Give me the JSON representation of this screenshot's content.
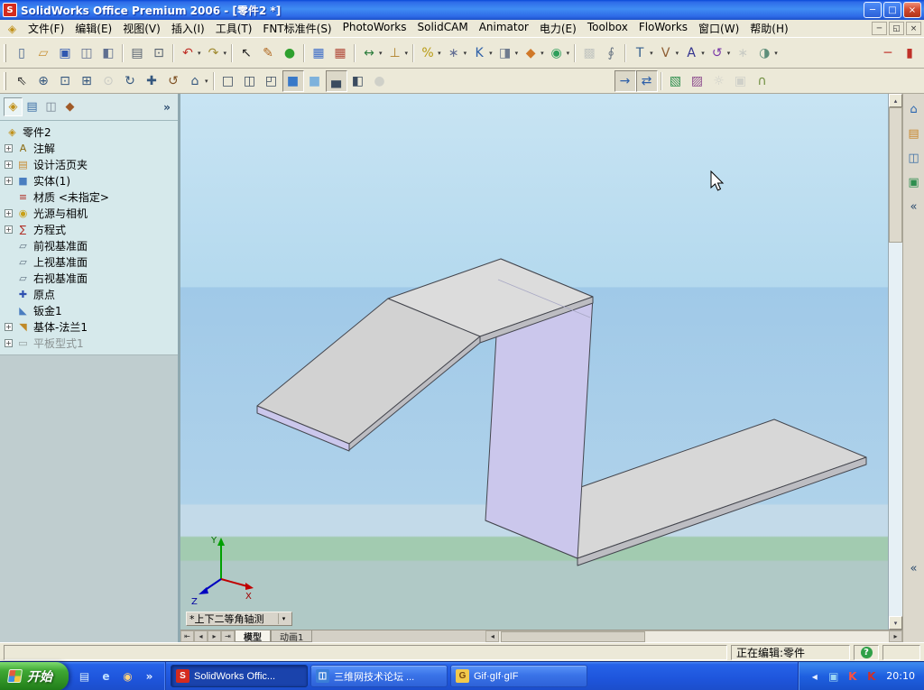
{
  "window_title": "SolidWorks Office Premium 2006 - [零件2 *]",
  "title_controls": [
    {
      "name": "minimize-button",
      "glyph": "─"
    },
    {
      "name": "maximize-button",
      "glyph": "□"
    },
    {
      "name": "close-button",
      "glyph": "×",
      "close": true
    }
  ],
  "menu_bar": {
    "items": [
      "文件(F)",
      "编辑(E)",
      "视图(V)",
      "插入(I)",
      "工具(T)",
      "FNT标准件(S)",
      "PhotoWorks",
      "SolidCAM",
      "Animator",
      "电力(E)",
      "Toolbox",
      "FloWorks",
      "窗口(W)",
      "帮助(H)"
    ],
    "doc_icon_glyph": "◈",
    "mdi_buttons": [
      {
        "name": "mdi-minimize-button",
        "glyph": "─"
      },
      {
        "name": "mdi-restore-button",
        "glyph": "◱"
      },
      {
        "name": "mdi-close-button",
        "glyph": "×"
      }
    ]
  },
  "toolbar_main": {
    "items": [
      {
        "name": "new-document-icon",
        "glyph": "▯",
        "color": "#44628E"
      },
      {
        "name": "open-document-icon",
        "glyph": "▱",
        "color": "#C89238"
      },
      {
        "name": "save-icon",
        "glyph": "▣",
        "color": "#3058B0"
      },
      {
        "name": "make-drawing-icon",
        "glyph": "◫",
        "color": "#607090"
      },
      {
        "name": "make-assembly-icon",
        "glyph": "◧",
        "color": "#607090"
      },
      {
        "sep": true
      },
      {
        "name": "print-icon",
        "glyph": "▤",
        "color": "#55606E"
      },
      {
        "name": "print-preview-icon",
        "glyph": "⊡",
        "color": "#55606E"
      },
      {
        "sep": true
      },
      {
        "name": "undo-icon",
        "glyph": "↶",
        "color": "#C03028",
        "dd": true
      },
      {
        "name": "redo-icon",
        "glyph": "↷",
        "color": "#A08A30",
        "dd": true
      },
      {
        "sep": true
      },
      {
        "name": "select-icon",
        "glyph": "↖",
        "color": "#222222"
      },
      {
        "name": "sketch-icon",
        "glyph": "✎",
        "color": "#B06820"
      },
      {
        "name": "rebuild-icon",
        "glyph": "●",
        "color": "#2EA02E"
      },
      {
        "sep": true
      },
      {
        "name": "sketch-grid-icon",
        "glyph": "▦",
        "color": "#3C6CC8"
      },
      {
        "name": "drawing-grid-icon",
        "glyph": "▦",
        "color": "#B04838"
      },
      {
        "sep": true
      },
      {
        "name": "dimension-icon",
        "glyph": "↔",
        "color": "#2E7E3E",
        "dd": true
      },
      {
        "name": "relations-icon",
        "glyph": "⊥",
        "color": "#B08028",
        "dd": true
      },
      {
        "sep": true
      },
      {
        "name": "features-icon",
        "glyph": "%",
        "color": "#B89A10",
        "dd": true
      },
      {
        "name": "pattern-icon",
        "glyph": "∗",
        "color": "#606C92",
        "dd": true
      },
      {
        "name": "measure-icon",
        "glyph": "K",
        "color": "#2D5FA8",
        "dd": true
      },
      {
        "name": "section-tool-icon",
        "glyph": "◨",
        "color": "#707C8E",
        "dd": true
      },
      {
        "name": "curvature-tool-icon",
        "glyph": "◆",
        "color": "#D07828",
        "dd": true
      },
      {
        "name": "simulation-icon",
        "glyph": "◉",
        "color": "#2E9E5B",
        "dd": true
      },
      {
        "sep": true
      },
      {
        "name": "tolerance-icon",
        "glyph": "▩",
        "color": "#8A94A0",
        "disabled": true
      },
      {
        "name": "attachment-icon",
        "glyph": "∮",
        "color": "#6A7684"
      },
      {
        "sep": true
      },
      {
        "name": "toolbox-icon",
        "glyph": "T",
        "color": "#335E8E",
        "dd": true
      },
      {
        "name": "vault-icon",
        "glyph": "V",
        "color": "#8E5E33",
        "dd": true
      },
      {
        "name": "analysis-icon",
        "glyph": "A",
        "color": "#32328E",
        "dd": true
      },
      {
        "name": "floworks-icon",
        "glyph": "↺",
        "color": "#7A38A8",
        "dd": true
      },
      {
        "name": "motion-icon",
        "glyph": "∗",
        "color": "#9AA4AA",
        "disabled": true
      },
      {
        "name": "render-icon",
        "glyph": "◑",
        "color": "#5E8E7A",
        "dd": true
      }
    ],
    "right_items": [
      {
        "name": "collapse-toolbar-icon",
        "glyph": "─",
        "color": "#C03028"
      },
      {
        "name": "expand-toolbar-icon",
        "glyph": "▮",
        "color": "#C03028"
      }
    ]
  },
  "toolbar_view": {
    "items": [
      {
        "name": "select-filter-icon",
        "glyph": "⇖",
        "color": "#333333"
      },
      {
        "name": "zoom-in-out-icon",
        "glyph": "⊕",
        "color": "#35577E"
      },
      {
        "name": "zoom-fit-icon",
        "glyph": "⊡",
        "color": "#35577E"
      },
      {
        "name": "zoom-area-icon",
        "glyph": "⊞",
        "color": "#35577E"
      },
      {
        "name": "zoom-selection-icon",
        "glyph": "⊙",
        "color": "#9AA0A8",
        "disabled": true
      },
      {
        "name": "rotate-view-icon",
        "glyph": "↻",
        "color": "#35577E"
      },
      {
        "name": "pan-icon",
        "glyph": "✚",
        "color": "#35577E"
      },
      {
        "name": "rotate-3d-icon",
        "glyph": "↺",
        "color": "#7E5022"
      },
      {
        "name": "standard-views-icon",
        "glyph": "⌂",
        "color": "#35577E",
        "dd": true
      },
      {
        "sep": true
      },
      {
        "name": "wireframe-icon",
        "glyph": "□",
        "color": "#3C4C60"
      },
      {
        "name": "hidden-lines-visible-icon",
        "glyph": "◫",
        "color": "#3C4C60"
      },
      {
        "name": "hidden-lines-removed-icon",
        "glyph": "◰",
        "color": "#3C4C60"
      },
      {
        "name": "shaded-with-edges-icon",
        "glyph": "■",
        "color": "#3878C8",
        "pressed": true
      },
      {
        "name": "shaded-icon",
        "glyph": "■",
        "color": "#7EB2DC"
      },
      {
        "name": "shadows-icon",
        "glyph": "▄",
        "color": "#3C4C60",
        "pressed": true
      },
      {
        "name": "section-view-icon",
        "glyph": "◧",
        "color": "#3C4C60"
      },
      {
        "name": "realview-icon",
        "glyph": "●",
        "color": "#A8AEB4",
        "disabled": true
      },
      {
        "space": true
      },
      {
        "name": "normal-to-icon",
        "glyph": "→",
        "color": "#2D5FA8",
        "pressed": true
      },
      {
        "name": "link-views-icon",
        "glyph": "⇄",
        "color": "#2D5FA8",
        "pressed": true
      },
      {
        "sep": true
      },
      {
        "name": "apply-scene-icon",
        "glyph": "▧",
        "color": "#2E8E4E"
      },
      {
        "name": "edit-scene-icon",
        "glyph": "▨",
        "color": "#8E4E8E"
      },
      {
        "name": "lights-icon",
        "glyph": "☼",
        "color": "#A8AEB4",
        "disabled": true
      },
      {
        "name": "camera-icon",
        "glyph": "▣",
        "color": "#A8AEB4",
        "disabled": true
      },
      {
        "name": "curvature-display-icon",
        "glyph": "∩",
        "color": "#6E8E3E"
      }
    ]
  },
  "feature_tree": {
    "header_tabs": [
      {
        "name": "tab-featuremanager",
        "glyph": "◈",
        "color": "#C09018",
        "pressed": true
      },
      {
        "name": "tab-propertymanager",
        "glyph": "▤",
        "color": "#3A6EA5"
      },
      {
        "name": "tab-configurationmanager",
        "glyph": "◫",
        "color": "#7A8694"
      },
      {
        "name": "tab-add-in",
        "glyph": "◆",
        "color": "#A05A28"
      }
    ],
    "collapse_glyph": "»",
    "items": [
      {
        "label": "零件2",
        "icon": "part",
        "icon_glyph": "◈",
        "icon_color": "#C09018",
        "root": true
      },
      {
        "label": "注解",
        "icon": "annotations",
        "icon_glyph": "A",
        "icon_color": "#8A6A10",
        "plus": true
      },
      {
        "label": "设计活页夹",
        "icon": "design-binder",
        "icon_glyph": "▤",
        "icon_color": "#C8862A",
        "plus": true
      },
      {
        "label": "实体(1)",
        "icon": "solid-bodies",
        "icon_glyph": "■",
        "icon_color": "#4A7EC0",
        "plus": true
      },
      {
        "label": "材质 <未指定>",
        "icon": "material",
        "icon_glyph": "≡",
        "icon_color": "#B03028"
      },
      {
        "label": "光源与相机",
        "icon": "lights-cameras",
        "icon_glyph": "◉",
        "icon_color": "#C8A018",
        "plus": true
      },
      {
        "label": "方程式",
        "icon": "equations",
        "icon_glyph": "∑",
        "icon_color": "#B03028",
        "plus": true
      },
      {
        "label": "前视基准面",
        "icon": "front-plane",
        "icon_glyph": "▱",
        "icon_color": "#5E7080"
      },
      {
        "label": "上视基准面",
        "icon": "top-plane",
        "icon_glyph": "▱",
        "icon_color": "#5E7080"
      },
      {
        "label": "右视基准面",
        "icon": "right-plane",
        "icon_glyph": "▱",
        "icon_color": "#5E7080"
      },
      {
        "label": "原点",
        "icon": "origin",
        "icon_glyph": "✚",
        "icon_color": "#2E50B0"
      },
      {
        "label": "钣金1",
        "icon": "sheet-metal",
        "icon_glyph": "◣",
        "icon_color": "#4A7EC0"
      },
      {
        "label": "基体-法兰1",
        "icon": "base-flange",
        "icon_glyph": "◥",
        "icon_color": "#C08A28",
        "plus": true
      },
      {
        "label": "平板型式1",
        "icon": "flat-pattern",
        "icon_glyph": "▭",
        "icon_color": "#909A9A",
        "plus": true,
        "grayed": true
      }
    ]
  },
  "viewport": {
    "view_label": "*上下二等角轴测",
    "view_dropdown_glyph": "▾",
    "triad": {
      "x": "X",
      "y": "Y",
      "z": "Z"
    },
    "tabs": [
      {
        "name": "model-tab",
        "label": "模型",
        "active": true
      },
      {
        "name": "animation-tab",
        "label": "动画1",
        "active": false
      }
    ],
    "nav_buttons": [
      {
        "name": "tab-first-button",
        "glyph": "⇤"
      },
      {
        "name": "tab-prev-button",
        "glyph": "◂"
      },
      {
        "name": "tab-next-button",
        "glyph": "▸"
      },
      {
        "name": "tab-last-button",
        "glyph": "⇥"
      }
    ],
    "scroll": {
      "up": "▴",
      "down": "▾",
      "left": "◂",
      "right": "▸"
    }
  },
  "task_pane": {
    "icons": [
      {
        "name": "solidworks-resources-icon",
        "glyph": "⌂",
        "color": "#2A66B0"
      },
      {
        "name": "design-library-icon",
        "glyph": "▤",
        "color": "#C8862A"
      },
      {
        "name": "file-explorer-icon",
        "glyph": "◫",
        "color": "#3A6EA5"
      },
      {
        "name": "view-palette-icon",
        "glyph": "▣",
        "color": "#2E8E4E"
      },
      {
        "name": "collapse-taskpane-icon",
        "glyph": "«",
        "color": "#2A4A6E"
      }
    ],
    "lower_collapse_glyph": "«"
  },
  "status_bar": {
    "editing": "正在编辑:零件",
    "help_glyph": "?"
  },
  "taskbar": {
    "start_label": "开始",
    "quick_launch": [
      {
        "name": "show-desktop-icon",
        "glyph": "▤",
        "color": "#D8ECFA"
      },
      {
        "name": "internet-explorer-icon",
        "glyph": "e",
        "color": "#BFE0FF"
      },
      {
        "name": "media-player-icon",
        "glyph": "◉",
        "color": "#FFD27E"
      },
      {
        "name": "quick-launch-more-icon",
        "glyph": "»",
        "color": "#E8F2FF"
      }
    ],
    "tasks": [
      {
        "name": "task-solidworks",
        "label": "SolidWorks Offic...",
        "icon_glyph": "S",
        "icon_color": "#ffffff",
        "icon_bg": "#D42B1E",
        "active": true
      },
      {
        "name": "task-forum",
        "label": "三维网技术论坛 ...",
        "icon_glyph": "◫",
        "icon_color": "#ffffff",
        "icon_bg": "#3A7ED8",
        "active": false
      },
      {
        "name": "task-gif",
        "label": "Gif·gIf·gIF",
        "icon_glyph": "G",
        "icon_color": "#7A4A10",
        "icon_bg": "#F2C94C",
        "active": false
      }
    ],
    "tray": {
      "items": [
        {
          "name": "tray-hide-icons-icon",
          "glyph": "◂",
          "color": "#E8F0FF"
        },
        {
          "name": "tray-network-icon",
          "glyph": "▣",
          "color": "#9AD4F4"
        },
        {
          "name": "tray-codec-icon",
          "glyph": "K",
          "color": "#FF5040"
        },
        {
          "name": "tray-codec2-icon",
          "glyph": "K",
          "color": "#D03028"
        }
      ],
      "time": "20:10"
    }
  },
  "colors": {
    "vp1": "#C8E4F3",
    "vp2": "#B4D9EE",
    "vp3": "#A0C9E8",
    "vp4": "#AFD2EA",
    "vp5": "#C3DAE9",
    "vp6": "#A2CBB0",
    "vp7": "#B0C9C6",
    "part_top": "#D7D7D7",
    "part_band": "#BDBDC2",
    "part_side": "#CBC7EC",
    "part_edge": "#44464E"
  }
}
